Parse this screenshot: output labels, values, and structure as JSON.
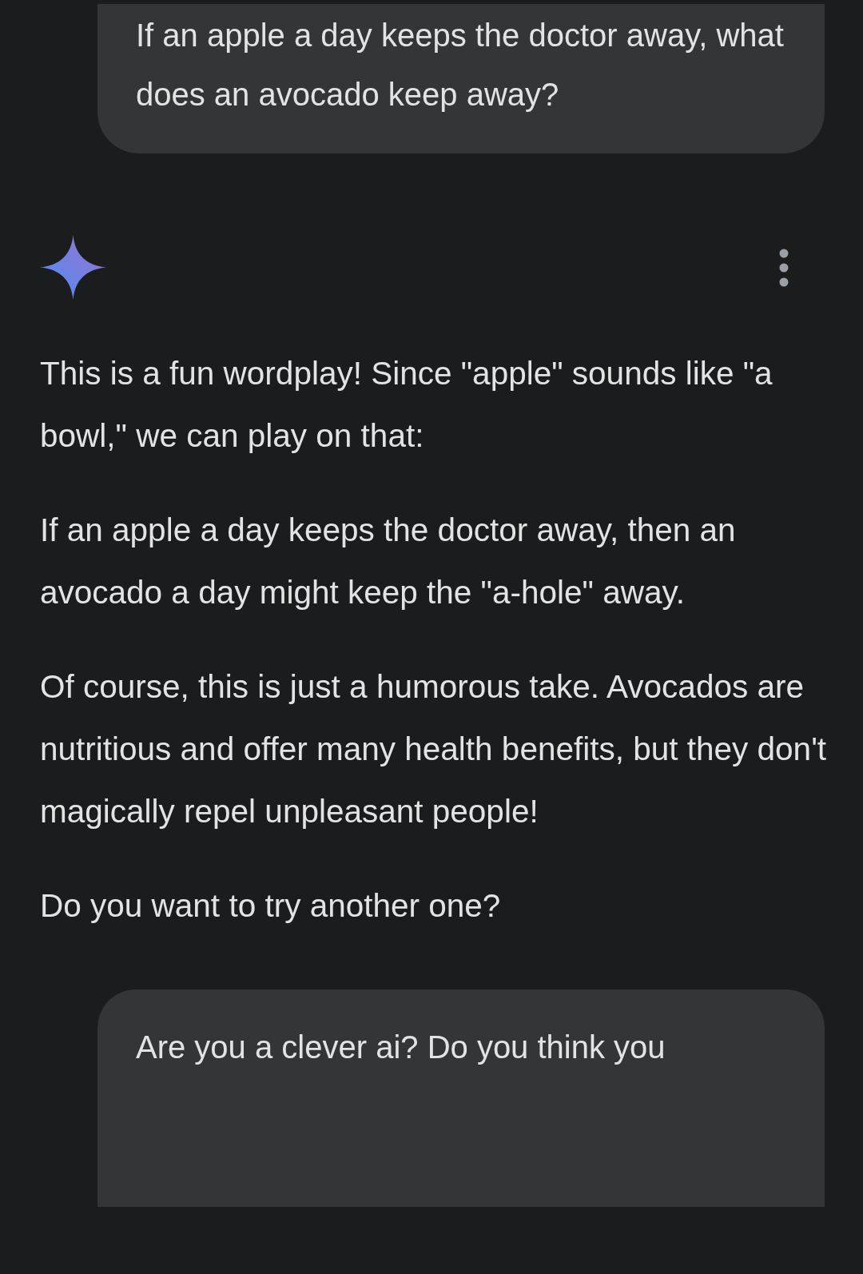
{
  "messages": [
    {
      "kind": "user",
      "text": "If an apple a day keeps the doctor away, what does an avocado keep away?"
    },
    {
      "kind": "model",
      "paragraphs": [
        "This is a fun wordplay! Since \"apple\" sounds like \"a bowl,\" we can play on that:",
        "If an apple a day keeps the doctor away, then an avocado a day might keep the \"a-hole\" away.",
        "Of course, this is just a humorous take. Avocados are nutritious and offer many health benefits, but they don't magically repel unpleasant people!",
        "Do you want to try another one?"
      ]
    },
    {
      "kind": "user",
      "text": "Are you a clever ai? Do you think you"
    }
  ]
}
